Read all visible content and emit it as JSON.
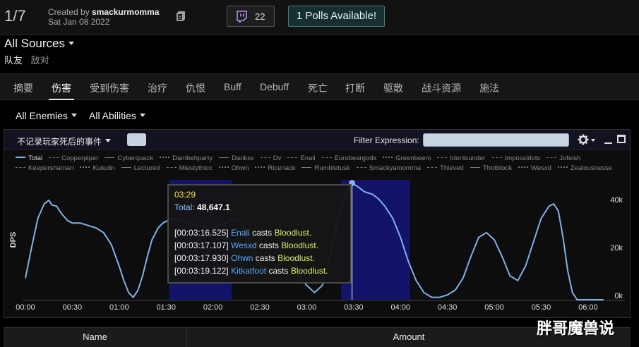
{
  "header": {
    "fight_index": "1/7",
    "created_prefix": "Created by ",
    "created_by": "smackurmomma",
    "date": "Sat Jan 08 2022",
    "twitch_count": "22",
    "polls_label": "1 Polls Available!"
  },
  "sources": {
    "label": "All Sources",
    "friendly": "队友",
    "enemy": "敌对"
  },
  "tabs": [
    "摘要",
    "伤害",
    "受到伤害",
    "治疗",
    "仇恨",
    "Buff",
    "Debuff",
    "死亡",
    "打断",
    "驱散",
    "战斗资源",
    "施法"
  ],
  "active_tab": "伤害",
  "filters": {
    "enemies": "All Enemies",
    "abilities": "All Abilities"
  },
  "panel": {
    "death_toggle_label": "不记录玩家死后的事件",
    "filter_label": "Filter Expression:",
    "filter_value": ""
  },
  "legend": [
    {
      "name": "Total",
      "style": "solid"
    },
    {
      "name": "Copperpiper",
      "style": "dash"
    },
    {
      "name": "Cyberquack",
      "style": "solid"
    },
    {
      "name": "Dambehparty",
      "style": "dot"
    },
    {
      "name": "Dankxx",
      "style": "solid"
    },
    {
      "name": "Dv",
      "style": "dash"
    },
    {
      "name": "Enali",
      "style": "dash"
    },
    {
      "name": "Eurobeargodx",
      "style": "dash"
    },
    {
      "name": "Greenbeem",
      "style": "dot"
    },
    {
      "name": "Idontsunder",
      "style": "dash"
    },
    {
      "name": "Impossidots",
      "style": "dash"
    },
    {
      "name": "Jofeish",
      "style": "dash"
    },
    {
      "name": "Keepershaman",
      "style": "dash"
    },
    {
      "name": "Kukulin",
      "style": "dot"
    },
    {
      "name": "Lectured",
      "style": "solid"
    },
    {
      "name": "Miestythicc",
      "style": "dash"
    },
    {
      "name": "Ohwn",
      "style": "dot"
    },
    {
      "name": "Ricenack",
      "style": "dot"
    },
    {
      "name": "Rumbletusk",
      "style": "solid"
    },
    {
      "name": "Smackyamomma",
      "style": "dash"
    },
    {
      "name": "Thieved",
      "style": "dash"
    },
    {
      "name": "Thotblock",
      "style": "solid"
    },
    {
      "name": "Wesxd",
      "style": "dot"
    },
    {
      "name": "Zealousnesse",
      "style": "dot"
    }
  ],
  "tooltip": {
    "time": "03:29",
    "total_label": "Total:",
    "total_value": "48,647.1",
    "events": [
      {
        "ts": "[00:03:16.525]",
        "player": "Enali",
        "verb": "casts",
        "spell": "Bloodlust."
      },
      {
        "ts": "[00:03:17.107]",
        "player": "Wesxd",
        "verb": "casts",
        "spell": "Bloodlust."
      },
      {
        "ts": "[00:03:17.930]",
        "player": "Ohwn",
        "verb": "casts",
        "spell": "Bloodlust."
      },
      {
        "ts": "[00:03:19.122]",
        "player": "Kitkatfoot",
        "verb": "casts",
        "spell": "Bloodlust."
      }
    ]
  },
  "table": {
    "name_header": "Name",
    "amount_header": "Amount"
  },
  "watermark": "胖哥魔兽说",
  "chart_data": {
    "type": "line",
    "ylabel": "DPS",
    "xlabel": "",
    "ylim": [
      0,
      50000
    ],
    "xlim_seconds": [
      0,
      370
    ],
    "x_tick_labels": [
      "00:00",
      "00:30",
      "01:00",
      "01:30",
      "02:00",
      "02:30",
      "03:00",
      "03:30",
      "04:00",
      "04:30",
      "05:00",
      "05:30",
      "06:00"
    ],
    "y_tick_labels": [
      "0k",
      "20k",
      "40k"
    ],
    "y_ticks": [
      0,
      20000,
      40000
    ],
    "highlight_bands_seconds": [
      [
        92,
        132
      ],
      [
        202,
        246
      ]
    ],
    "cursor_seconds": 209,
    "series": [
      {
        "name": "Total",
        "color": "#7fb2e6",
        "x": [
          0,
          4,
          8,
          12,
          15,
          17,
          20,
          23,
          27,
          30,
          35,
          40,
          45,
          50,
          55,
          60,
          63,
          66,
          69,
          72,
          75,
          78,
          81,
          85,
          88,
          91,
          95,
          100,
          105,
          110,
          115,
          120,
          125,
          130,
          135,
          140,
          145,
          150,
          155,
          160,
          165,
          170,
          175,
          180,
          185,
          190,
          195,
          200,
          205,
          209,
          213,
          217,
          222,
          226,
          230,
          235,
          240,
          245,
          250,
          255,
          260,
          265,
          270,
          275,
          280,
          285,
          290,
          295,
          300,
          305,
          310,
          315,
          320,
          325,
          330,
          335,
          338,
          341,
          344,
          347,
          350,
          353,
          356,
          360,
          365,
          370
        ],
        "values": [
          9000,
          22000,
          34000,
          40000,
          41500,
          39500,
          39000,
          36000,
          33000,
          32000,
          32000,
          31000,
          30000,
          28000,
          23000,
          14000,
          8000,
          3000,
          1000,
          4000,
          10000,
          18000,
          25000,
          30000,
          32000,
          33000,
          34000,
          33000,
          32000,
          31000,
          30500,
          30000,
          31000,
          33000,
          34000,
          30000,
          22000,
          14000,
          12000,
          13000,
          16000,
          18000,
          10000,
          6000,
          3000,
          6000,
          18000,
          34000,
          44000,
          48647,
          47000,
          45000,
          44000,
          42000,
          39000,
          34000,
          26000,
          16000,
          8000,
          3000,
          1000,
          1000,
          2000,
          4000,
          9000,
          18000,
          26000,
          28000,
          25000,
          18000,
          10000,
          8000,
          14000,
          24000,
          34000,
          39000,
          40000,
          37000,
          26000,
          12000,
          3000,
          0,
          0,
          0,
          0,
          0
        ]
      }
    ]
  }
}
